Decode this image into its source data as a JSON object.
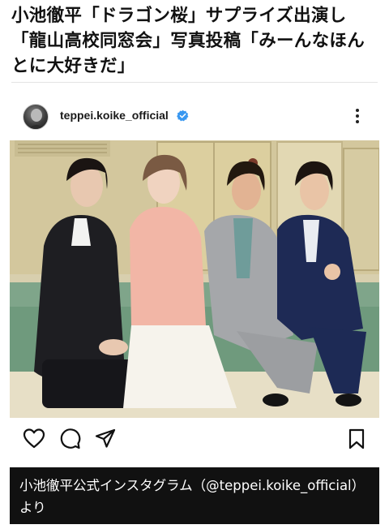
{
  "article": {
    "headline": "小池徹平「ドラゴン桜」サプライズ出演し「龍山高校同窓会」写真投稿「みーんなほんとに大好きだ」"
  },
  "post": {
    "username": "teppei.koike_official",
    "verified": true,
    "icons": {
      "avatar": "profile-avatar",
      "verified": "verified-badge-icon",
      "more": "more-options-icon",
      "like": "heart-icon",
      "comment": "comment-icon",
      "share": "send-icon",
      "save": "bookmark-icon"
    },
    "accent_color": "#3897f0"
  },
  "caption": {
    "text": "小池徹平公式インスタグラム（@teppei.koike_official）より"
  }
}
